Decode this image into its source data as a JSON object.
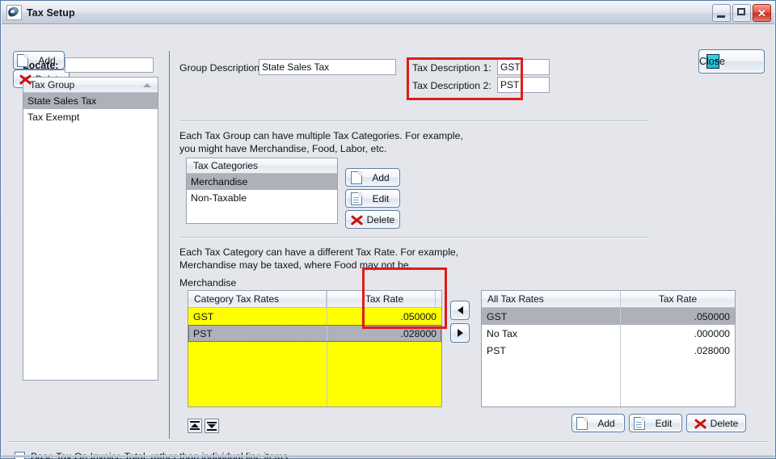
{
  "window": {
    "title": "Tax Setup",
    "app_icon": "app-swoosh-icon",
    "minimize_label": "",
    "maximize_label": "",
    "close_label": "✕"
  },
  "toolbar": {
    "close_button_label": "Close",
    "close_button_icon": "door-exit-icon"
  },
  "left_panel": {
    "locate_label": "Locate:",
    "locate_value": "",
    "locate_placeholder": "",
    "list_header": "Tax Group",
    "list_items": [
      {
        "label": "State Sales Tax",
        "selected": true
      },
      {
        "label": "Tax Exempt",
        "selected": false
      }
    ],
    "add_label": "Add",
    "delete_label": "Delete"
  },
  "group": {
    "description_label": "Group Description:",
    "description_value": "State Sales Tax",
    "tax_description_1_label": "Tax Description 1:",
    "tax_description_1_value": "GST",
    "tax_description_2_label": "Tax Description 2:",
    "tax_description_2_value": "PST"
  },
  "categories": {
    "help_line_1": "Each Tax Group can have multiple Tax Categories.  For example,",
    "help_line_2": "you might have Merchandise, Food, Labor, etc.",
    "list_header": "Tax Categories",
    "items": [
      {
        "label": "Merchandise",
        "selected": true
      },
      {
        "label": "Non-Taxable",
        "selected": false
      }
    ],
    "add_label": "Add",
    "edit_label": "Edit",
    "delete_label": "Delete"
  },
  "rates": {
    "help_line_1": "Each Tax Category can have a different Tax Rate.  For example,",
    "help_line_2": "Merchandise may be taxed, where Food may not be.",
    "current_category": "Merchandise",
    "category_grid": {
      "columns": [
        "Category Tax Rates",
        "",
        "Tax Rate"
      ],
      "rows": [
        {
          "name": "GST",
          "rate": ".050000",
          "selected": false
        },
        {
          "name": "PST",
          "rate": ".028000",
          "selected": true
        }
      ]
    },
    "all_grid": {
      "columns": [
        "All Tax Rates",
        "Tax Rate"
      ],
      "rows": [
        {
          "name": "GST",
          "rate": ".050000",
          "selected": true
        },
        {
          "name": "No Tax",
          "rate": ".000000",
          "selected": false
        },
        {
          "name": "PST",
          "rate": ".028000",
          "selected": false
        }
      ]
    },
    "move_left_icon": "arrow-left-icon",
    "move_right_icon": "arrow-right-icon",
    "move_up_icon": "move-up-icon",
    "move_down_icon": "move-down-icon",
    "all_add_label": "Add",
    "all_edit_label": "Edit",
    "all_delete_label": "Delete"
  },
  "footer": {
    "checkbox_label": "Base Tax On Invoice Total, rather than individual line items",
    "checkbox_checked": false
  },
  "annotations": {
    "accent_color": "#e01b1b",
    "boxes": [
      {
        "name": "tax-description-highlight"
      },
      {
        "name": "tax-rate-column-highlight"
      }
    ]
  },
  "colors": {
    "selection_gray": "#aeb1ba",
    "highlight_yellow": "#ffff00",
    "window_bg": "#e4e6eb"
  }
}
